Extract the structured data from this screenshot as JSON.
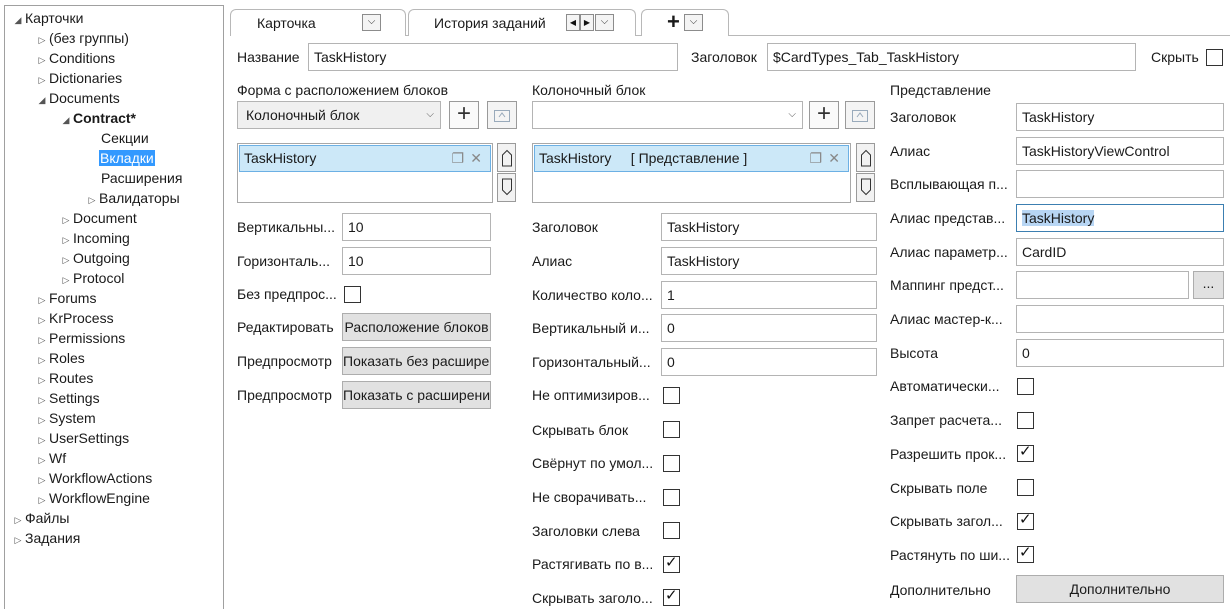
{
  "tree": {
    "root": "Карточки",
    "items": [
      {
        "label": "(без группы)",
        "arrow": "▷"
      },
      {
        "label": "Conditions",
        "arrow": "▷"
      },
      {
        "label": "Dictionaries",
        "arrow": "▷"
      },
      {
        "label": "Documents",
        "arrow": "◢"
      },
      {
        "label": "Contract*",
        "arrow": "◢"
      },
      {
        "label": "Секции",
        "arrow": ""
      },
      {
        "label": "Вкладки",
        "arrow": ""
      },
      {
        "label": "Расширения",
        "arrow": ""
      },
      {
        "label": "Валидаторы",
        "arrow": "▷"
      },
      {
        "label": "Document",
        "arrow": "▷"
      },
      {
        "label": "Incoming",
        "arrow": "▷"
      },
      {
        "label": "Outgoing",
        "arrow": "▷"
      },
      {
        "label": "Protocol",
        "arrow": "▷"
      },
      {
        "label": "Forums",
        "arrow": "▷"
      },
      {
        "label": "KrProcess",
        "arrow": "▷"
      },
      {
        "label": "Permissions",
        "arrow": "▷"
      },
      {
        "label": "Roles",
        "arrow": "▷"
      },
      {
        "label": "Routes",
        "arrow": "▷"
      },
      {
        "label": "Settings",
        "arrow": "▷"
      },
      {
        "label": "System",
        "arrow": "▷"
      },
      {
        "label": "UserSettings",
        "arrow": "▷"
      },
      {
        "label": "Wf",
        "arrow": "▷"
      },
      {
        "label": "WorkflowActions",
        "arrow": "▷"
      },
      {
        "label": "WorkflowEngine",
        "arrow": "▷"
      },
      {
        "label": "Файлы",
        "arrow": "▷"
      },
      {
        "label": "Задания",
        "arrow": "▷"
      }
    ],
    "root_arrow": "◢"
  },
  "tabs": [
    {
      "label": "Карточка"
    },
    {
      "label": "История заданий"
    }
  ],
  "glyphs": {
    "chevron": "⌵",
    "nav_left": "◀",
    "nav_right": "▶",
    "plus": "+",
    "check": "✓",
    "up": "⌂",
    "down": "⌂",
    "copy": "❐",
    "close": "✕",
    "ellipsis": "..."
  },
  "header": {
    "name_label": "Название",
    "name_value": "TaskHistory",
    "title_label": "Заголовок",
    "title_value": "$CardTypes_Tab_TaskHistory",
    "hide_label": "Скрыть"
  },
  "col1": {
    "section_label": "Форма с расположением блоков",
    "combo_value": "Колоночный блок",
    "list_item": "TaskHistory",
    "rows": [
      {
        "label": "Вертикальны...",
        "value": "10"
      },
      {
        "label": "Горизонталь...",
        "value": "10"
      }
    ],
    "nopreview_label": "Без предпрос...",
    "edit_label": "Редактировать",
    "edit_button": "Расположение блоков",
    "preview1_label": "Предпросмотр",
    "preview1_button": "Показать без расширени",
    "preview2_label": "Предпросмотр",
    "preview2_button": "Показать с расширениям"
  },
  "col2": {
    "section_label": "Колоночный блок",
    "combo_value": "",
    "list_item": "TaskHistory     [ Представление ]",
    "fields": [
      {
        "label": "Заголовок",
        "value": "TaskHistory"
      },
      {
        "label": "Алиас",
        "value": "TaskHistory"
      },
      {
        "label": "Количество коло...",
        "value": "1"
      },
      {
        "label": "Вертикальный и...",
        "value": "0"
      },
      {
        "label": "Горизонтальный...",
        "value": "0"
      }
    ],
    "checks": [
      {
        "label": "Не оптимизиров...",
        "checked": false
      },
      {
        "label": "Скрывать блок",
        "checked": false
      },
      {
        "label": "Свёрнут по умол...",
        "checked": false
      },
      {
        "label": "Не сворачивать...",
        "checked": false
      },
      {
        "label": "Заголовки слева",
        "checked": false
      },
      {
        "label": "Растягивать по в...",
        "checked": true
      },
      {
        "label": "Скрывать заголо...",
        "checked": true
      }
    ]
  },
  "col3": {
    "section_label": "Представление",
    "fields": [
      {
        "label": "Заголовок",
        "value": "TaskHistory"
      },
      {
        "label": "Алиас",
        "value": "TaskHistoryViewControl"
      },
      {
        "label": "Всплывающая п...",
        "value": ""
      },
      {
        "label": "Алиас представ...",
        "value": "TaskHistory"
      },
      {
        "label": "Алиас параметр...",
        "value": "CardID"
      },
      {
        "label": "Маппинг предст...",
        "value": ""
      },
      {
        "label": "Алиас мастер-к...",
        "value": ""
      },
      {
        "label": "Высота",
        "value": "0"
      }
    ],
    "checks": [
      {
        "label": "Автоматически...",
        "checked": false
      },
      {
        "label": "Запрет расчета...",
        "checked": false
      },
      {
        "label": "Разрешить прок...",
        "checked": true
      },
      {
        "label": "Скрывать поле",
        "checked": false
      },
      {
        "label": "Скрывать загол...",
        "checked": true
      },
      {
        "label": "Растянуть по ши...",
        "checked": true
      }
    ],
    "extra_label": "Дополнительно",
    "extra_button": "Дополнительно"
  }
}
